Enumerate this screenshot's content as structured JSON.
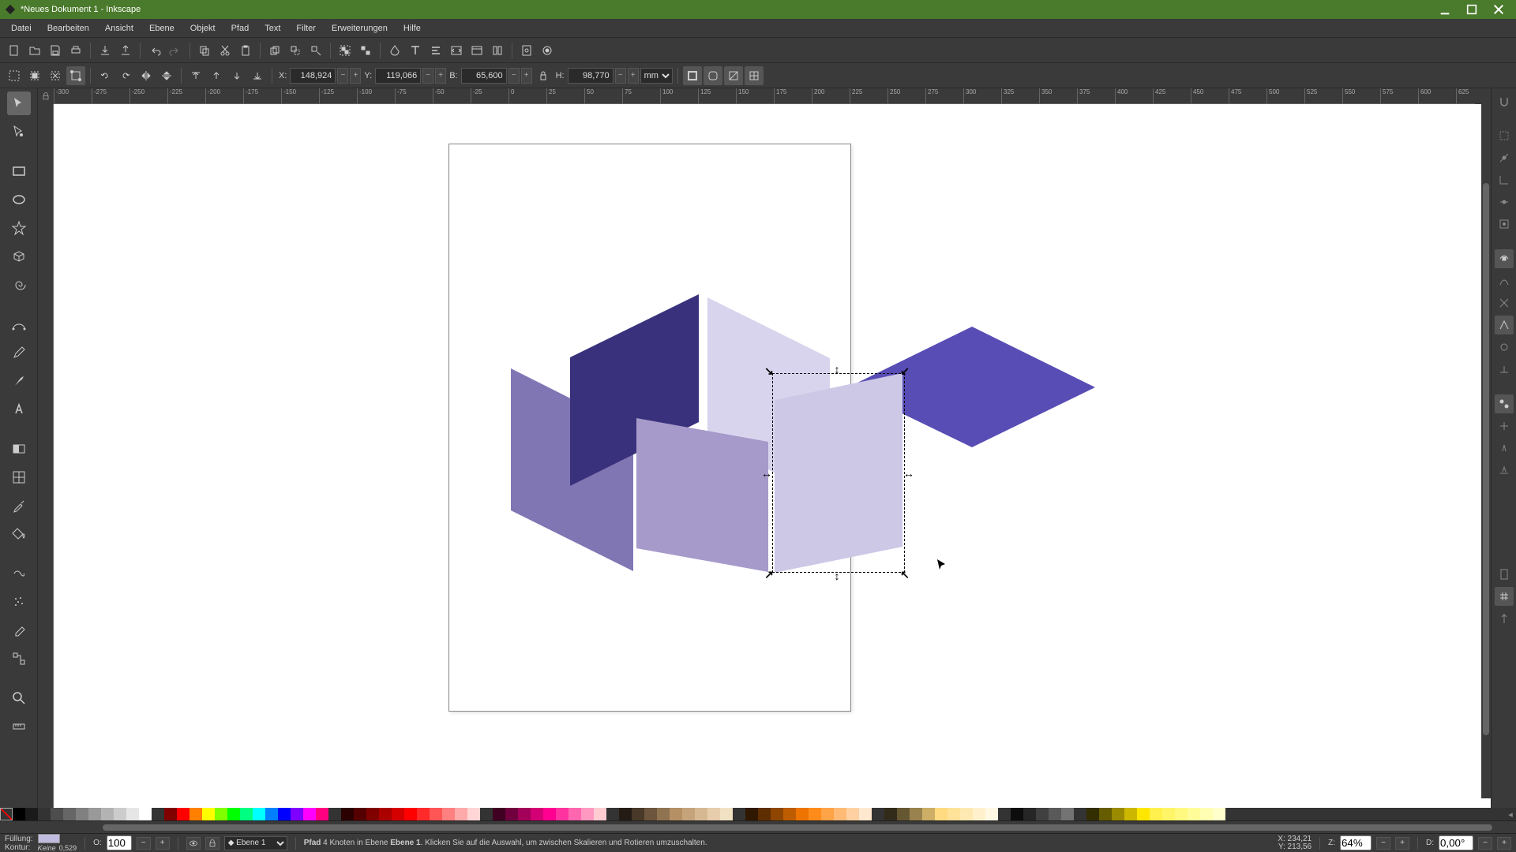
{
  "window": {
    "title": "*Neues Dokument 1 - Inkscape"
  },
  "menu": {
    "items": [
      "Datei",
      "Bearbeiten",
      "Ansicht",
      "Ebene",
      "Objekt",
      "Pfad",
      "Text",
      "Filter",
      "Erweiterungen",
      "Hilfe"
    ]
  },
  "tool_options": {
    "x_label": "X:",
    "x_value": "148,924",
    "y_label": "Y:",
    "y_value": "119,066",
    "w_label": "B:",
    "w_value": "65,600",
    "h_label": "H:",
    "h_value": "98,770",
    "unit": "mm"
  },
  "ruler": {
    "marks": [
      "-300",
      "-275",
      "-250",
      "-225",
      "-200",
      "-175",
      "-150",
      "-125",
      "-100",
      "-75",
      "-50",
      "-25",
      "0",
      "25",
      "50",
      "75",
      "100",
      "125",
      "150",
      "175",
      "200",
      "225",
      "250",
      "275",
      "300",
      "325",
      "350",
      "375",
      "400",
      "425",
      "450",
      "475",
      "500",
      "525",
      "550",
      "575",
      "600",
      "625"
    ]
  },
  "status": {
    "fill_label": "Füllung:",
    "fill_color": "#c0bce0",
    "stroke_label": "Kontur:",
    "stroke_value": "Keine",
    "stroke_width": "0,529",
    "opacity_label": "O:",
    "opacity_value": "100",
    "layer_label": "Ebene 1",
    "msg_strong1": "Pfad",
    "msg_mid": " 4 Knoten in Ebene ",
    "msg_strong2": "Ebene 1",
    "msg_rest": ". Klicken Sie auf die Auswahl, um zwischen Skalieren und Rotieren umzuschalten.",
    "coord_x_label": "X:",
    "coord_x": "234,21",
    "coord_y_label": "Y:",
    "coord_y": "213,56",
    "zoom_label": "Z:",
    "zoom": "64%",
    "rot_label": "D:",
    "rotation": "0,00°"
  },
  "colors": {
    "grays": [
      "#000000",
      "#1a1a1a",
      "#333333",
      "#4d4d4d",
      "#666666",
      "#808080",
      "#999999",
      "#b3b3b3",
      "#cccccc",
      "#e6e6e6",
      "#ffffff"
    ],
    "basic": [
      "#800000",
      "#ff0000",
      "#ff8000",
      "#ffff00",
      "#80ff00",
      "#00ff00",
      "#00ff80",
      "#00ffff",
      "#0080ff",
      "#0000ff",
      "#8000ff",
      "#ff00ff",
      "#ff0080"
    ],
    "reds": [
      "#2b0000",
      "#550000",
      "#800000",
      "#aa0000",
      "#d40000",
      "#ff0000",
      "#ff2a2a",
      "#ff5555",
      "#ff8080",
      "#ffaaaa",
      "#ffd5d5"
    ],
    "pinks": [
      "#3f0022",
      "#71003e",
      "#a20059",
      "#d40075",
      "#ff0090",
      "#ff339f",
      "#ff66b0",
      "#ff99c1",
      "#ffccd2"
    ],
    "browns": [
      "#241c14",
      "#483928",
      "#6c553c",
      "#907350",
      "#b49064",
      "#c5a47b",
      "#d6b993",
      "#e7cdab",
      "#f1e2c4"
    ],
    "oranges": [
      "#301700",
      "#5f2e00",
      "#8e4600",
      "#be5d00",
      "#ed7400",
      "#ff8c1a",
      "#ffa347",
      "#ffba75",
      "#ffd1a2",
      "#ffe8d0"
    ],
    "tans": [
      "#332b1a",
      "#665733",
      "#99824d",
      "#ccae66",
      "#ffda80",
      "#ffe299",
      "#ffe9b2",
      "#fff1cc",
      "#fff8e5"
    ],
    "darkgrays": [
      "#0d0d0d",
      "#262626",
      "#404040",
      "#595959",
      "#737373"
    ],
    "yellows": [
      "#332e00",
      "#665c00",
      "#998a00",
      "#ccb800",
      "#ffe600",
      "#fff04d",
      "#fff566",
      "#fff980",
      "#fffc99",
      "#fffeb2",
      "#ffffcc"
    ]
  }
}
